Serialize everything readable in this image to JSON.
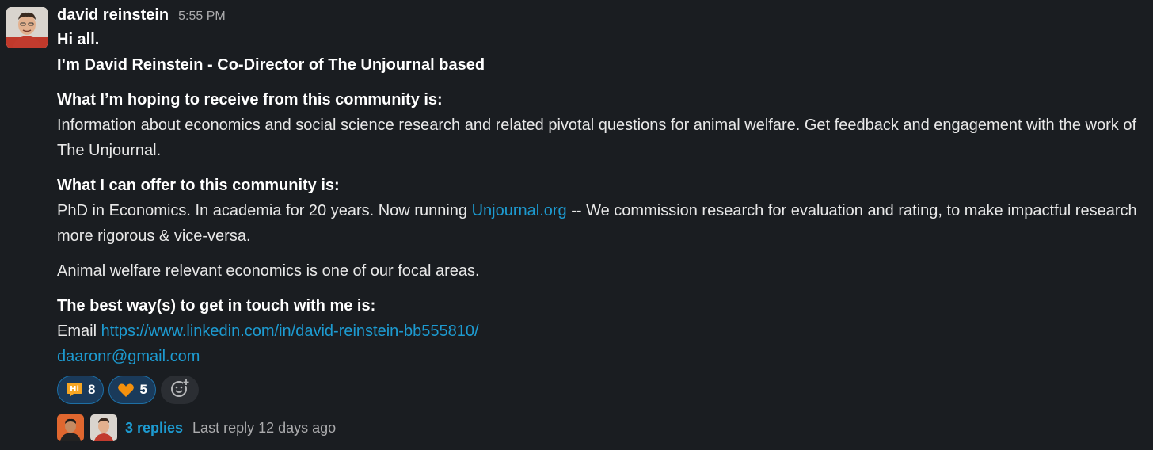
{
  "message": {
    "author": "david reinstein",
    "timestamp": "5:55 PM",
    "greeting": "Hi all.",
    "intro": "I’m David Reinstein - Co-Director of The Unjournal based",
    "section1_heading": "What I’m hoping to receive from this community is:",
    "section1_body": "Information about economics and social science research and related pivotal questions for animal welfare. Get feedback and engagement with the work of The Unjournal.",
    "section2_heading": "What I can offer to this community is:",
    "section2_body_pre": "PhD in Economics. In academia for 20 years. Now running ",
    "section2_link": "Unjournal.org",
    "section2_body_post": " -- We commission research for evaluation and rating, to make impactful research more rigorous & vice-versa.",
    "section3_body": "Animal welfare relevant economics is one of our focal areas.",
    "section4_heading": "The best way(s) to get in touch with me is:",
    "email_label": "Email ",
    "linkedin_link": "https://www.linkedin.com/in/david-reinstein-bb555810/",
    "email_link": "daaronr@gmail.com"
  },
  "reactions": [
    {
      "icon": "hi-speech-bubble-icon",
      "count": "8"
    },
    {
      "icon": "orange-heart-icon",
      "count": "5"
    }
  ],
  "thread": {
    "replies": "3 replies",
    "last_reply": "Last reply 12 days ago"
  },
  "colors": {
    "background": "#1a1d21",
    "link": "#1d9bd1",
    "reaction_bg": "#1a3a5a",
    "reaction_border": "#1d6fa5"
  }
}
